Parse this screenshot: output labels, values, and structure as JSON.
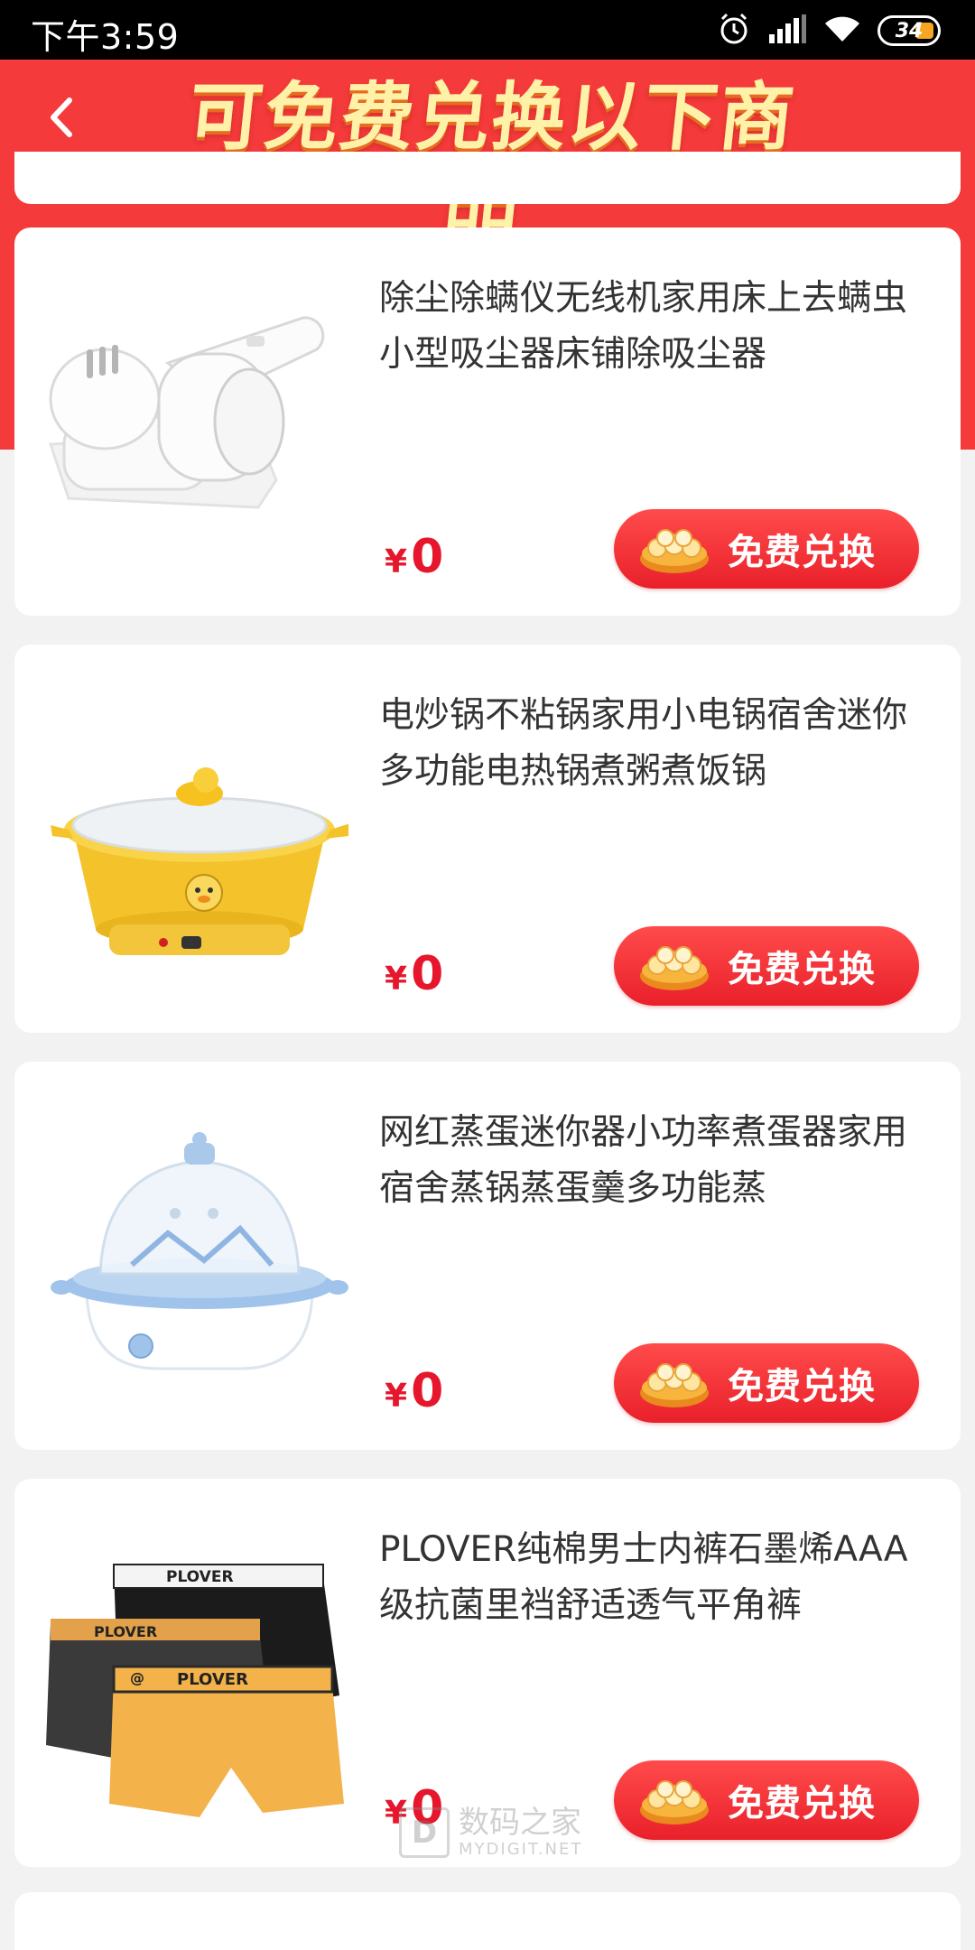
{
  "status_bar": {
    "time": "下午3:59",
    "battery": "34"
  },
  "header": {
    "title": "可免费兑换以下商品"
  },
  "colors": {
    "brand_red": "#f43a3a",
    "price_red": "#e6162c",
    "title_yellow": "#fff2a8"
  },
  "products": [
    {
      "title": "除尘除螨仪无线机家用床上去螨虫小型吸尘器床铺除吸尘器",
      "currency": "¥",
      "price": "0",
      "button_label": "免费兑换",
      "image_icon": "mite-remover-image"
    },
    {
      "title": "电炒锅不粘锅家用小电锅宿舍迷你多功能电热锅煮粥煮饭锅",
      "currency": "¥",
      "price": "0",
      "button_label": "免费兑换",
      "image_icon": "electric-pot-image"
    },
    {
      "title": "网红蒸蛋迷你器小功率煮蛋器家用宿舍蒸锅蒸蛋羹多功能蒸",
      "currency": "¥",
      "price": "0",
      "button_label": "免费兑换",
      "image_icon": "egg-steamer-image"
    },
    {
      "title": "PLOVER纯棉男士内裤石墨烯AAA级抗菌里裆舒适透气平角裤",
      "currency": "¥",
      "price": "0",
      "button_label": "免费兑换",
      "image_icon": "underwear-image"
    }
  ],
  "watermark": {
    "main": "数码之家",
    "sub": "MYDIGIT.NET",
    "logo": "D"
  }
}
